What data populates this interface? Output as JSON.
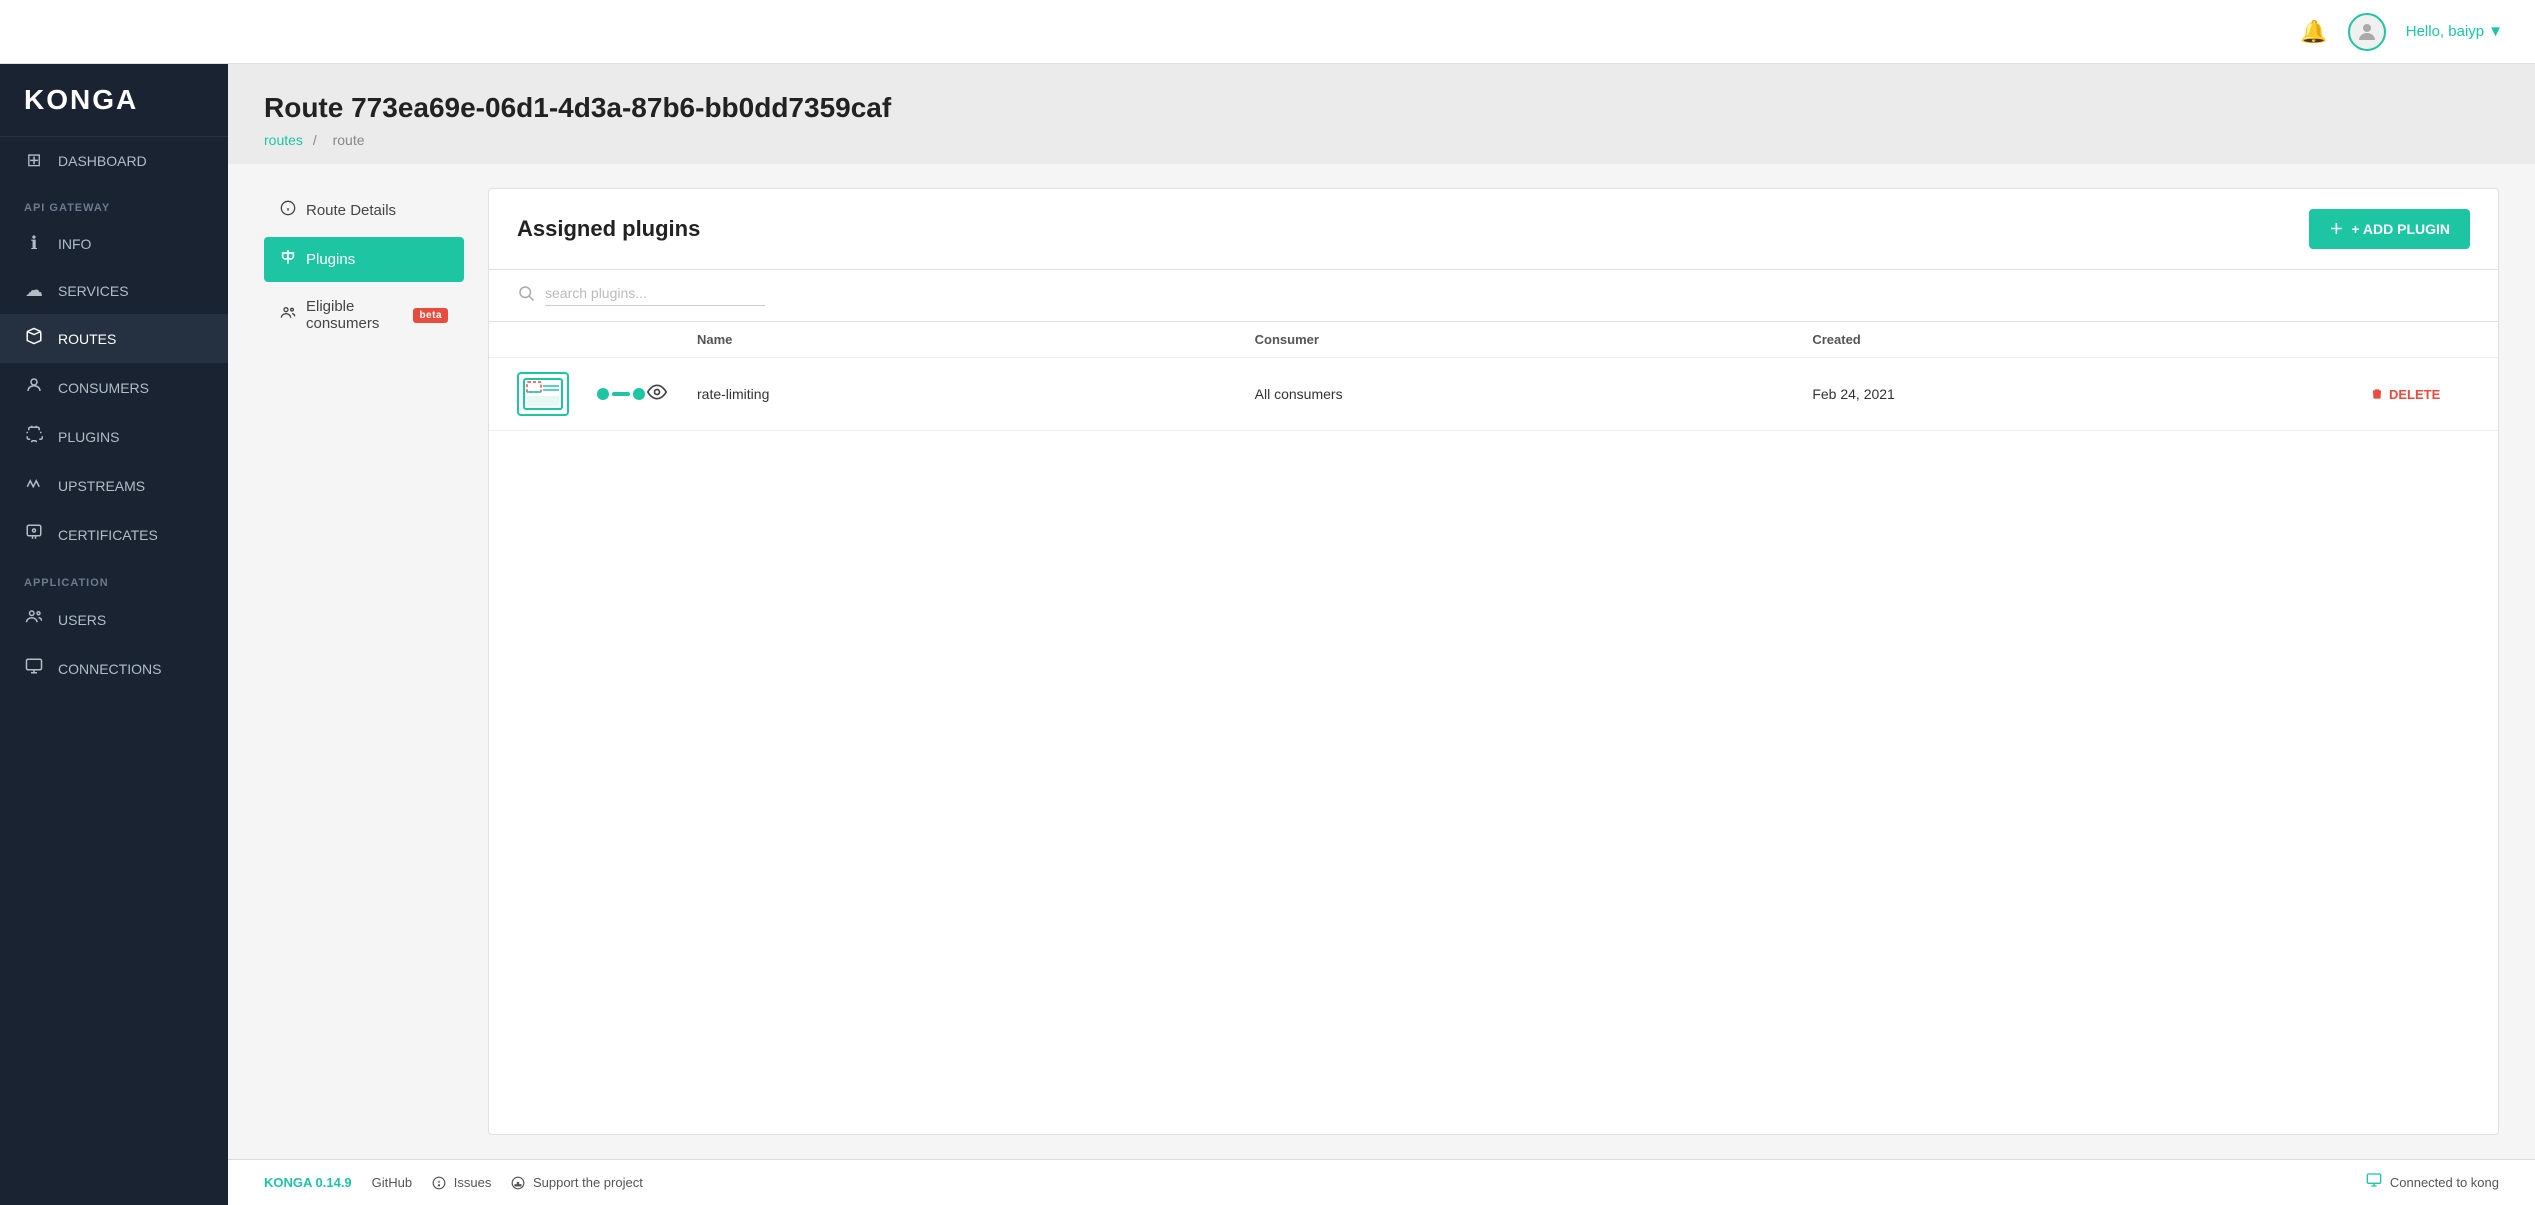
{
  "app": {
    "logo": "KONGA",
    "version": "KONGA 0.14.9"
  },
  "topbar": {
    "hello_text": "Hello, baiyp",
    "caret": "▼"
  },
  "sidebar": {
    "section1_label": "API GATEWAY",
    "section2_label": "APPLICATION",
    "items": [
      {
        "id": "dashboard",
        "label": "DASHBOARD",
        "icon": "⊞"
      },
      {
        "id": "info",
        "label": "INFO",
        "icon": "ℹ"
      },
      {
        "id": "services",
        "label": "SERVICES",
        "icon": "☁"
      },
      {
        "id": "routes",
        "label": "ROUTES",
        "icon": "⚡",
        "active": true
      },
      {
        "id": "consumers",
        "label": "CONSUMERS",
        "icon": "👤"
      },
      {
        "id": "plugins",
        "label": "PLUGINS",
        "icon": "🔌"
      },
      {
        "id": "upstreams",
        "label": "UPSTREAMS",
        "icon": "✂"
      },
      {
        "id": "certificates",
        "label": "CERTIFICATES",
        "icon": "🏅"
      },
      {
        "id": "users",
        "label": "USERS",
        "icon": "👥"
      },
      {
        "id": "connections",
        "label": "CONNECTIONS",
        "icon": "📺"
      }
    ]
  },
  "page": {
    "title": "Route 773ea69e-06d1-4d3a-87b6-bb0dd7359caf",
    "breadcrumb_link": "routes",
    "breadcrumb_sep": "/",
    "breadcrumb_current": "route"
  },
  "left_nav": {
    "items": [
      {
        "id": "route-details",
        "label": "Route Details",
        "icon": "ℹ",
        "active": false
      },
      {
        "id": "plugins",
        "label": "Plugins",
        "icon": "🔌",
        "active": true
      },
      {
        "id": "eligible-consumers",
        "label": "Eligible consumers",
        "icon": "👥",
        "active": false,
        "badge": "beta"
      }
    ]
  },
  "panel": {
    "title": "Assigned plugins",
    "add_button_label": "+ ADD PLUGIN",
    "search_placeholder": "search plugins...",
    "table_headers": {
      "col1": "",
      "col2": "",
      "col3": "",
      "col4": "Name",
      "col5": "Consumer",
      "col6": "Created",
      "col7": ""
    },
    "plugins": [
      {
        "id": "rate-limiting",
        "name": "rate-limiting",
        "consumer": "All consumers",
        "created": "Feb 24, 2021",
        "status": "active"
      }
    ],
    "delete_label": "DELETE"
  },
  "footer": {
    "version": "KONGA 0.14.9",
    "github": "GitHub",
    "issues": "Issues",
    "support": "Support the project",
    "connected_text": "Connected to kong"
  }
}
